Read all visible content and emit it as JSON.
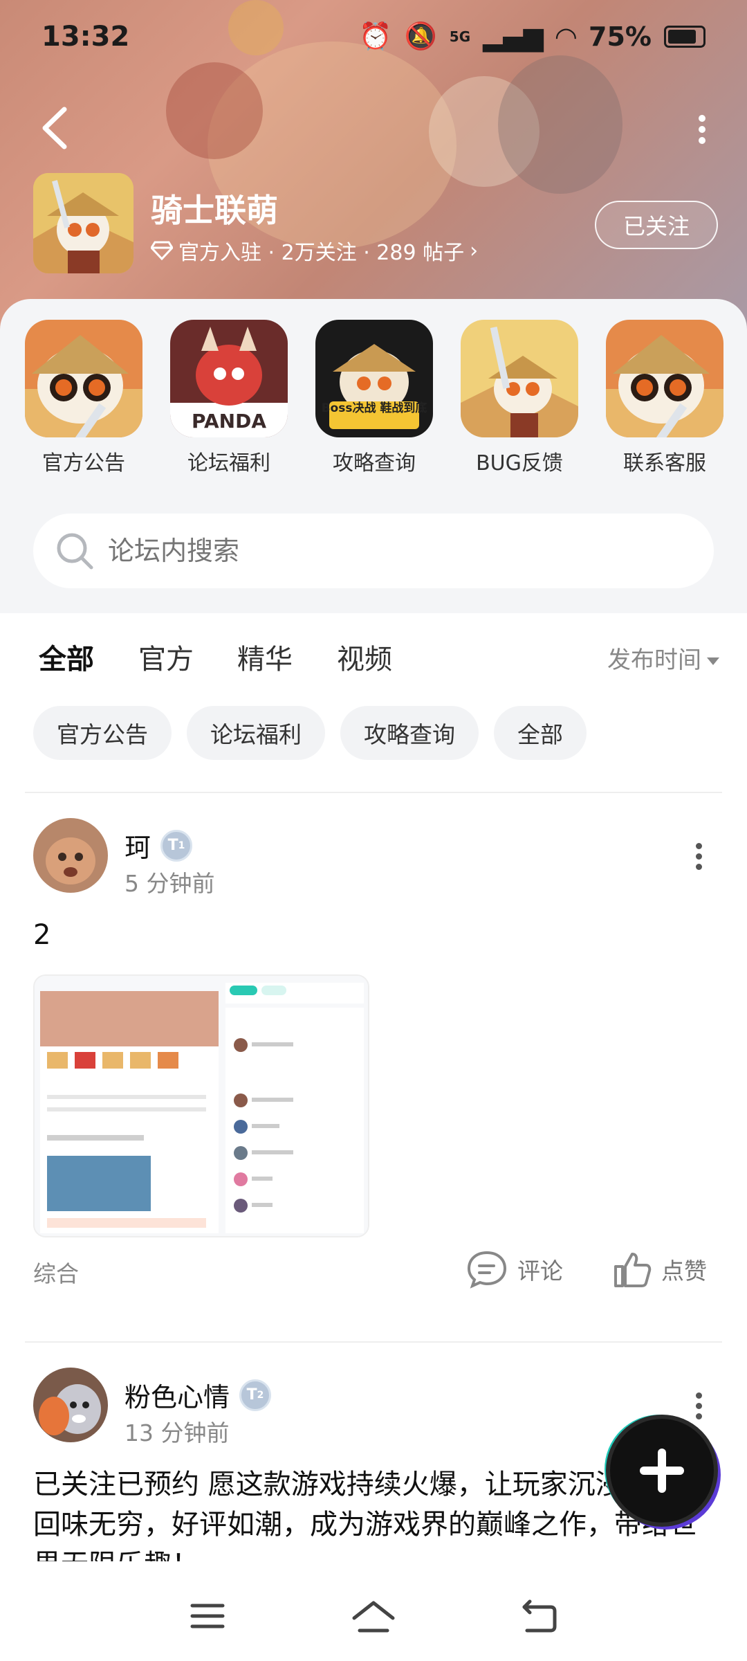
{
  "status_bar": {
    "time": "13:32",
    "network": "5G",
    "battery": "75%"
  },
  "forum": {
    "name": "骑士联萌",
    "meta": "官方入驻 · 2万关注 · 289 帖子",
    "follow_label": "已关注"
  },
  "shortcuts": [
    {
      "label": "官方公告",
      "icon": "panda-knight-icon"
    },
    {
      "label": "论坛福利",
      "icon": "red-dragon-panda-icon",
      "badge": "PANDA"
    },
    {
      "label": "攻略查询",
      "icon": "boss-guide-icon",
      "badge": "Boss决战 鞋战到底"
    },
    {
      "label": "BUG反馈",
      "icon": "knight-sword-icon"
    },
    {
      "label": "联系客服",
      "icon": "panda-sword-icon"
    }
  ],
  "search": {
    "placeholder": "论坛内搜索"
  },
  "tabs": [
    {
      "label": "全部",
      "active": true
    },
    {
      "label": "官方",
      "active": false
    },
    {
      "label": "精华",
      "active": false
    },
    {
      "label": "视频",
      "active": false
    }
  ],
  "sort_label": "发布时间",
  "chips": [
    "官方公告",
    "论坛福利",
    "攻略查询",
    "全部"
  ],
  "posts": [
    {
      "user": "珂",
      "level": "1",
      "time": "5 分钟前",
      "text": "2",
      "category": "综合",
      "comment_label": "评论",
      "like_label": "点赞"
    },
    {
      "user": "粉色心情",
      "level": "2",
      "time": "13 分钟前",
      "text": "已关注已预约 愿这款游戏持续火爆，让玩家沉浸其中，回味无穷，好评如潮，成为游戏界的巅峰之作，带给世界无限乐趣！"
    }
  ],
  "colors": {
    "accent": "#29c9b3",
    "banner": "#c98a76"
  }
}
